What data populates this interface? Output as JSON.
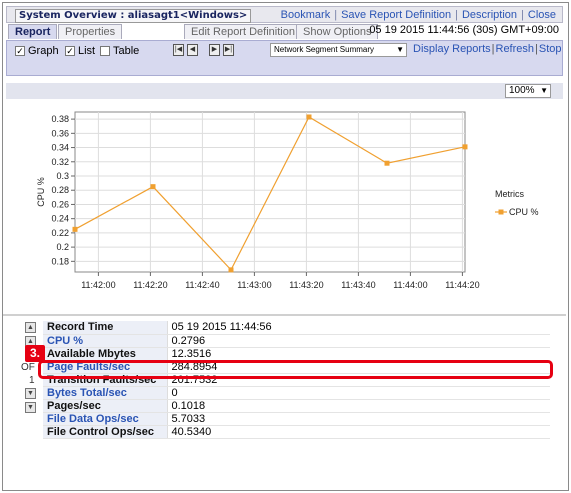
{
  "window": {
    "title": "System Overview : aliasagt1<Windows>",
    "links": [
      "Bookmark",
      "Save Report Definition",
      "Description",
      "Close"
    ]
  },
  "tabs": {
    "report": "Report",
    "properties": "Properties",
    "edit_report_definition": "Edit Report Definition",
    "show_options": "Show Options"
  },
  "timestamp": "05 19 2015 11:44:56 (30s)  GMT+09:00",
  "toolbar": {
    "graph_label": "Graph",
    "list_label": "List",
    "table_label": "Table",
    "graph_checked": true,
    "list_checked": true,
    "table_checked": false,
    "dropdown_value": "Network Segment Summary",
    "display_reports": "Display Reports",
    "refresh": "Refresh",
    "stop": "Stop"
  },
  "zoom": "100%",
  "chart_data": {
    "type": "line",
    "title": "",
    "xlabel": "",
    "ylabel": "CPU %",
    "x": [
      "11:41:51",
      "11:42:21",
      "11:42:51",
      "11:43:21",
      "11:43:51",
      "11:44:21"
    ],
    "x_ticks": [
      "11:42:00",
      "11:42:20",
      "11:42:40",
      "11:43:00",
      "11:43:20",
      "11:43:40",
      "11:44:00",
      "11:44:20"
    ],
    "y_ticks": [
      "0.18",
      "0.2",
      "0.22",
      "0.24",
      "0.26",
      "0.28",
      "0.3",
      "0.32",
      "0.34",
      "0.36",
      "0.38"
    ],
    "ylim": [
      0.165,
      0.39
    ],
    "series": [
      {
        "name": "CPU %",
        "values": [
          0.225,
          0.285,
          0.168,
          0.383,
          0.318,
          0.341
        ],
        "color": "#f0a030"
      }
    ],
    "legend": {
      "title": "Metrics",
      "position": "right"
    },
    "grid": true
  },
  "table": {
    "rows": [
      {
        "key": "Record Time",
        "value": "05 19 2015  11:44:56",
        "link": false
      },
      {
        "key": "CPU %",
        "value": "0.2796",
        "link": true
      },
      {
        "key": "Available Mbytes",
        "value": "12.3516",
        "link": false
      },
      {
        "key": "Page Faults/sec",
        "value": "284.8954",
        "link": true
      },
      {
        "key": "Transition Faults/sec",
        "value": "201.7532",
        "link": false
      },
      {
        "key": "Bytes Total/sec",
        "value": "0",
        "link": true
      },
      {
        "key": "Pages/sec",
        "value": "0.1018",
        "link": false
      },
      {
        "key": "File Data Ops/sec",
        "value": "5.7033",
        "link": true
      },
      {
        "key": "File Control Ops/sec",
        "value": "40.5340",
        "link": false
      }
    ]
  },
  "side_labels": {
    "of": "OF",
    "one": "1"
  },
  "callout": {
    "number": "3."
  }
}
